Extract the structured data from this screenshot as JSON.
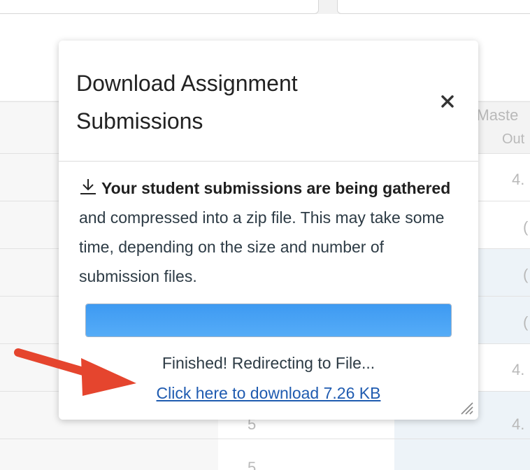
{
  "background": {
    "header_fragment_line1": "- Maste",
    "header_fragment_line2": "Out",
    "row_values_right": [
      "4.",
      "(",
      "(",
      "(",
      "4.",
      "4."
    ],
    "row_values_mid": [
      "5",
      "5"
    ]
  },
  "dialog": {
    "title": "Download Assignment Submissions",
    "close_icon": "close-icon",
    "body": {
      "icon": "download-icon",
      "bold_text": "Your student submissions are being gathered",
      "rest_text": " and compressed into a zip file. This may take some time, depending on the size and number of submission files."
    },
    "progress": {
      "value": 1.0
    },
    "status_text": "Finished! Redirecting to File...",
    "download_link": "Click here to download 7.26 KB"
  },
  "annotation": {
    "arrow_color": "#e5452e"
  },
  "colors": {
    "progress": "#4aa3f5",
    "link": "#1f5bb0",
    "text": "#2d3b45"
  }
}
